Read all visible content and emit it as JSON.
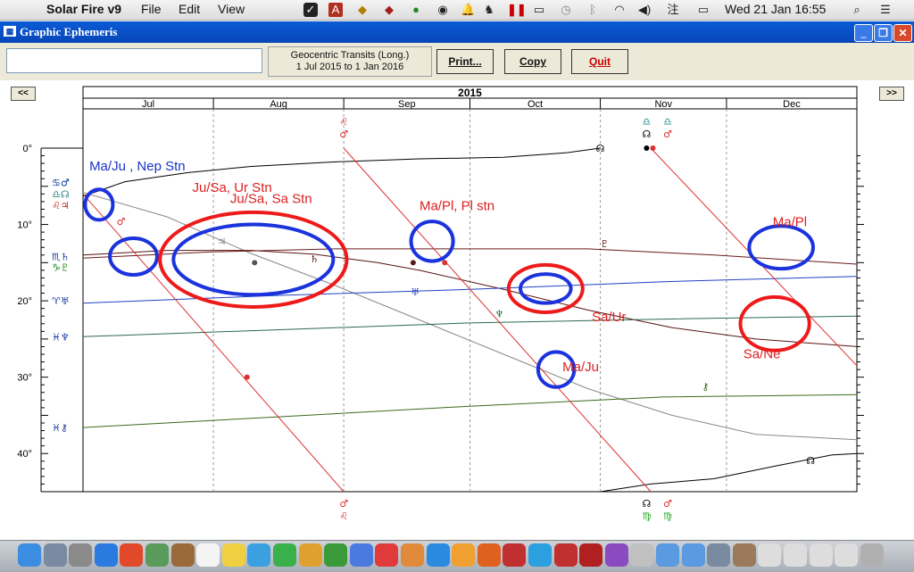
{
  "menubar": {
    "apple_glyph": "",
    "app": "Solar Fire v9",
    "items": [
      "File",
      "Edit",
      "View"
    ],
    "datetime": "Wed 21 Jan  16:55",
    "icons": [
      "scribe-icon",
      "dictionary-icon",
      "shield-icon",
      "antivirus-icon",
      "sync-icon",
      "onepassword-icon",
      "bell-icon",
      "evernote-icon",
      "pause-icon",
      "airplay-icon",
      "timemachine-icon",
      "bluetooth-icon",
      "wifi-icon",
      "volume-icon",
      "input-method-icon",
      "battery-icon",
      "search-icon",
      "list-icon"
    ],
    "input_glyph": "注"
  },
  "window": {
    "title": "Graphic Ephemeris",
    "buttons": {
      "minimize": "_",
      "restore": "❐",
      "close": "✕"
    }
  },
  "toolbar": {
    "edit_value": "",
    "mode_line1": "Geocentric Transits (Long.)",
    "mode_line2": "1 Jul 2015 to 1 Jan 2016",
    "print": "Print...",
    "copy": "Copy",
    "quit": "Quit"
  },
  "nav": {
    "prev": "<<",
    "next": ">>"
  },
  "chart_data": {
    "type": "line",
    "title": "2015",
    "months": [
      "Jul",
      "Aug",
      "Sep",
      "Oct",
      "Nov",
      "Dec"
    ],
    "x_unit": "days since 1 Jul 2015",
    "xlim": [
      0,
      184
    ],
    "ylim": [
      0,
      45
    ],
    "yticks": [
      0,
      10,
      20,
      30,
      40
    ],
    "ytick_labels": [
      "0°",
      "10°",
      "20°",
      "30°",
      "40°"
    ],
    "y_glyphs": [
      {
        "y": 4.5,
        "text": "♋♂",
        "color": "#003399"
      },
      {
        "y": 6.0,
        "text": "♎☊",
        "color": "#2a8a8a"
      },
      {
        "y": 7.5,
        "text": "♌♃",
        "color": "#cc2222"
      },
      {
        "y": 14.2,
        "text": "♏♄",
        "color": "#1a3aa0"
      },
      {
        "y": 15.6,
        "text": "♑♇",
        "color": "#1a8a1a"
      },
      {
        "y": 20.0,
        "text": "♈♅",
        "color": "#1a3aa0"
      },
      {
        "y": 24.7,
        "text": "♓♆",
        "color": "#1a3aa0"
      },
      {
        "y": 36.6,
        "text": "♓⚷",
        "color": "#1a3aa0"
      }
    ],
    "series": [
      {
        "name": "Node",
        "color": "#000000",
        "points": [
          [
            0,
            6.3
          ],
          [
            10,
            4.4
          ],
          [
            25,
            3.2
          ],
          [
            40,
            2.4
          ],
          [
            60,
            1.8
          ],
          [
            80,
            1.4
          ],
          [
            100,
            1.2
          ],
          [
            115,
            0.6
          ],
          [
            123,
            0
          ]
        ],
        "labels": [
          {
            "x": 123,
            "y": 0,
            "text": "☊"
          },
          {
            "x": 173,
            "y": 40.9,
            "text": "☊"
          }
        ]
      },
      {
        "name": "Node (wrap)",
        "color": "#000000",
        "points": [
          [
            123,
            45
          ],
          [
            135,
            44
          ],
          [
            150,
            43.3
          ],
          [
            165,
            41.6
          ],
          [
            178,
            40.2
          ],
          [
            184,
            40
          ]
        ],
        "labels": []
      },
      {
        "name": "Jupiter",
        "color": "#888888",
        "points": [
          [
            0,
            5.8
          ],
          [
            20,
            9
          ],
          [
            40,
            13.8
          ],
          [
            60,
            18
          ],
          [
            80,
            22.5
          ],
          [
            100,
            27
          ],
          [
            120,
            31.5
          ],
          [
            140,
            35
          ],
          [
            160,
            37.5
          ],
          [
            184,
            38.2
          ]
        ],
        "labels": [
          {
            "x": 33,
            "y": 12.2,
            "text": "♃"
          }
        ]
      },
      {
        "name": "Saturn",
        "color": "#5a1212",
        "points": [
          [
            0,
            14.0
          ],
          [
            20,
            13.4
          ],
          [
            40,
            13.4
          ],
          [
            55,
            13.9
          ],
          [
            70,
            15
          ],
          [
            80,
            16
          ],
          [
            100,
            18.5
          ],
          [
            120,
            21.2
          ],
          [
            140,
            23.5
          ],
          [
            160,
            25
          ],
          [
            184,
            26
          ]
        ],
        "labels": [
          {
            "x": 55,
            "y": 14.5,
            "text": "♄"
          }
        ]
      },
      {
        "name": "Pluto",
        "color": "#6a1a1a",
        "points": [
          [
            0,
            14.4
          ],
          [
            30,
            13.6
          ],
          [
            60,
            13.2
          ],
          [
            90,
            13.2
          ],
          [
            120,
            13.2
          ],
          [
            150,
            14.0
          ],
          [
            184,
            15.2
          ]
        ],
        "labels": [
          {
            "x": 124,
            "y": 12.5,
            "text": "♇"
          }
        ]
      },
      {
        "name": "Uranus",
        "color": "#2040c0",
        "points": [
          [
            0,
            20.3
          ],
          [
            46,
            19.3
          ],
          [
            92,
            18.5
          ],
          [
            138,
            17.5
          ],
          [
            184,
            16.8
          ]
        ],
        "labels": [
          {
            "x": 79,
            "y": 18.8,
            "text": "♅"
          }
        ]
      },
      {
        "name": "Neptune",
        "color": "#2a6a4a",
        "points": [
          [
            0,
            24.7
          ],
          [
            46,
            23.8
          ],
          [
            92,
            22.9
          ],
          [
            138,
            22.4
          ],
          [
            184,
            22.0
          ]
        ],
        "labels": [
          {
            "x": 99,
            "y": 21.7,
            "text": "♆"
          }
        ]
      },
      {
        "name": "Chiron",
        "color": "#3a6a1a",
        "points": [
          [
            0,
            36.6
          ],
          [
            46,
            35.2
          ],
          [
            92,
            33.8
          ],
          [
            138,
            32.6
          ],
          [
            184,
            32.3
          ]
        ],
        "labels": [
          {
            "x": 148,
            "y": 31.2,
            "text": "⚷"
          }
        ]
      },
      {
        "name": "Mars 1",
        "color": "#dd3030",
        "points": [
          [
            0,
            6
          ],
          [
            62,
            45
          ]
        ],
        "labels": [
          {
            "x": 9,
            "y": 9.6,
            "text": "♂"
          }
        ]
      },
      {
        "name": "Mars 2",
        "color": "#dd3030",
        "points": [
          [
            62,
            0
          ],
          [
            135,
            45
          ]
        ],
        "labels": []
      },
      {
        "name": "Mars 3",
        "color": "#dd3030",
        "points": [
          [
            135,
            0
          ],
          [
            184,
            28.5
          ]
        ],
        "labels": []
      }
    ],
    "dots": [
      {
        "x": 40.8,
        "y": 15.0,
        "color": "#555555"
      },
      {
        "name": "Ju-Sa",
        "x": 78.5,
        "y": 15.0,
        "color": "#5a1a1a"
      },
      {
        "x": 86,
        "y": 15.0,
        "color": "#dd3030"
      },
      {
        "x": 39,
        "y": 30,
        "color": "#dd3030"
      },
      {
        "x": 134,
        "y": 0,
        "color": "#000000"
      },
      {
        "x": 135.5,
        "y": 0,
        "color": "#dd3030"
      }
    ],
    "top_markers": [
      {
        "x": 62,
        "glyphs": [
          "♌",
          "♂"
        ],
        "colors": [
          "#dd3030",
          "#dd3030"
        ]
      },
      {
        "x": 134,
        "glyphs": [
          "♎",
          "☊"
        ],
        "colors": [
          "#2a8a8a",
          "#000000"
        ]
      },
      {
        "x": 139,
        "glyphs": [
          "♎",
          "♂"
        ],
        "colors": [
          "#2a8a8a",
          "#dd3030"
        ]
      }
    ],
    "bottom_markers": [
      {
        "x": 62,
        "glyphs": [
          "♂",
          "♌"
        ],
        "colors": [
          "#dd3030",
          "#dd3030"
        ]
      },
      {
        "x": 134,
        "glyphs": [
          "☊",
          "♍"
        ],
        "colors": [
          "#000000",
          "#22aa22"
        ]
      },
      {
        "x": 139,
        "glyphs": [
          "♂",
          "♍"
        ],
        "colors": [
          "#dd3030",
          "#22aa22"
        ]
      }
    ],
    "annotations": [
      {
        "text": "Ma/Ju , Nep Stn",
        "x": 1.5,
        "y": 2.2,
        "color": "#1a33cc"
      },
      {
        "text": "Ju/Sa, Ur Stn",
        "x": 26,
        "y": 5.0,
        "color": "#dd2020"
      },
      {
        "text": "Ju/Sa, Sa Stn",
        "x": 35,
        "y": 6.5,
        "color": "#dd2020"
      },
      {
        "text": "Ma/Pl, Pl stn",
        "x": 80,
        "y": 7.4,
        "color": "#dd2020"
      },
      {
        "text": "Ma/Pl",
        "x": 164,
        "y": 9.5,
        "color": "#dd2020"
      },
      {
        "text": "Sa/Ur",
        "x": 121,
        "y": 22.0,
        "color": "#dd2020"
      },
      {
        "text": "Sa/Ne",
        "x": 157,
        "y": 26.8,
        "color": "#dd2020"
      },
      {
        "text": "Ma/Ju",
        "x": 114,
        "y": 28.5,
        "color": "#dd2020"
      }
    ],
    "circles": [
      {
        "x": 3.8,
        "y": 7.4,
        "rx": 3.3,
        "ry": 2.0,
        "color": "#1a33dd"
      },
      {
        "x": 12,
        "y": 14.2,
        "rx": 5.6,
        "ry": 2.4,
        "color": "#1a33dd"
      },
      {
        "x": 40.5,
        "y": 14.6,
        "rx": 22.2,
        "ry": 6.2,
        "color": "#ee1a1a"
      },
      {
        "x": 40.5,
        "y": 14.6,
        "rx": 19,
        "ry": 4.6,
        "color": "#1a33dd"
      },
      {
        "x": 83,
        "y": 12.2,
        "rx": 5.0,
        "ry": 2.6,
        "color": "#1a33dd"
      },
      {
        "x": 110,
        "y": 18.4,
        "rx": 8.8,
        "ry": 3.1,
        "color": "#ee1a1a"
      },
      {
        "x": 110,
        "y": 18.4,
        "rx": 6.0,
        "ry": 1.9,
        "color": "#1a33dd"
      },
      {
        "x": 112.5,
        "y": 29.0,
        "rx": 4.3,
        "ry": 2.3,
        "color": "#1a33dd"
      },
      {
        "x": 164.5,
        "y": 23.0,
        "rx": 8.2,
        "ry": 3.5,
        "color": "#ee1a1a"
      },
      {
        "x": 166,
        "y": 13.0,
        "rx": 7.6,
        "ry": 2.8,
        "color": "#1a33dd"
      }
    ]
  },
  "dock": {
    "apps": [
      "finder",
      "launchpad",
      "system-prefs",
      "safari",
      "chrome",
      "preview",
      "notebook",
      "calendar",
      "notes",
      "messages",
      "facetime",
      "photos",
      "numbers",
      "keynote",
      "music",
      "books",
      "app-store",
      "pages",
      "firefox",
      "solar-fire",
      "skype",
      "parallels",
      "acrobat",
      "itunes-u",
      "photo-tool",
      "folder-1",
      "folder-2",
      "documents",
      "stack-1",
      "stack-2",
      "stack-3",
      "stack-4",
      "stack-5",
      "trash"
    ]
  }
}
